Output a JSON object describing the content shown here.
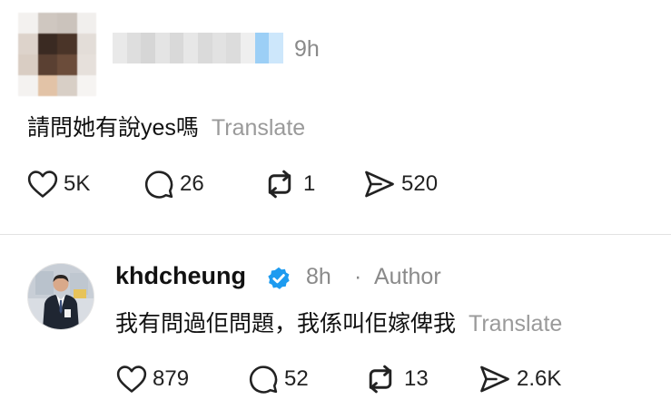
{
  "comment": {
    "time": "9h",
    "text": "請問她有說yes嗎",
    "translate": "Translate",
    "actions": {
      "likes": "5K",
      "replies": "26",
      "reposts": "1",
      "shares": "520"
    }
  },
  "reply": {
    "username": "khdcheung",
    "time": "8h",
    "separator": "·",
    "role": "Author",
    "text": "我有問過佢問題，我係叫佢嫁俾我",
    "translate": "Translate",
    "actions": {
      "likes": "879",
      "replies": "52",
      "reposts": "13",
      "shares": "2.6K"
    }
  },
  "colors": {
    "text": "#111111",
    "muted": "#8a8a8a",
    "verified": "#1d9bf0",
    "divider": "#e2e2e2"
  },
  "icons": {
    "like": "heart-icon",
    "reply": "comment-bubble-icon",
    "repost": "repost-icon",
    "share": "send-icon",
    "verified": "verified-badge-icon"
  }
}
